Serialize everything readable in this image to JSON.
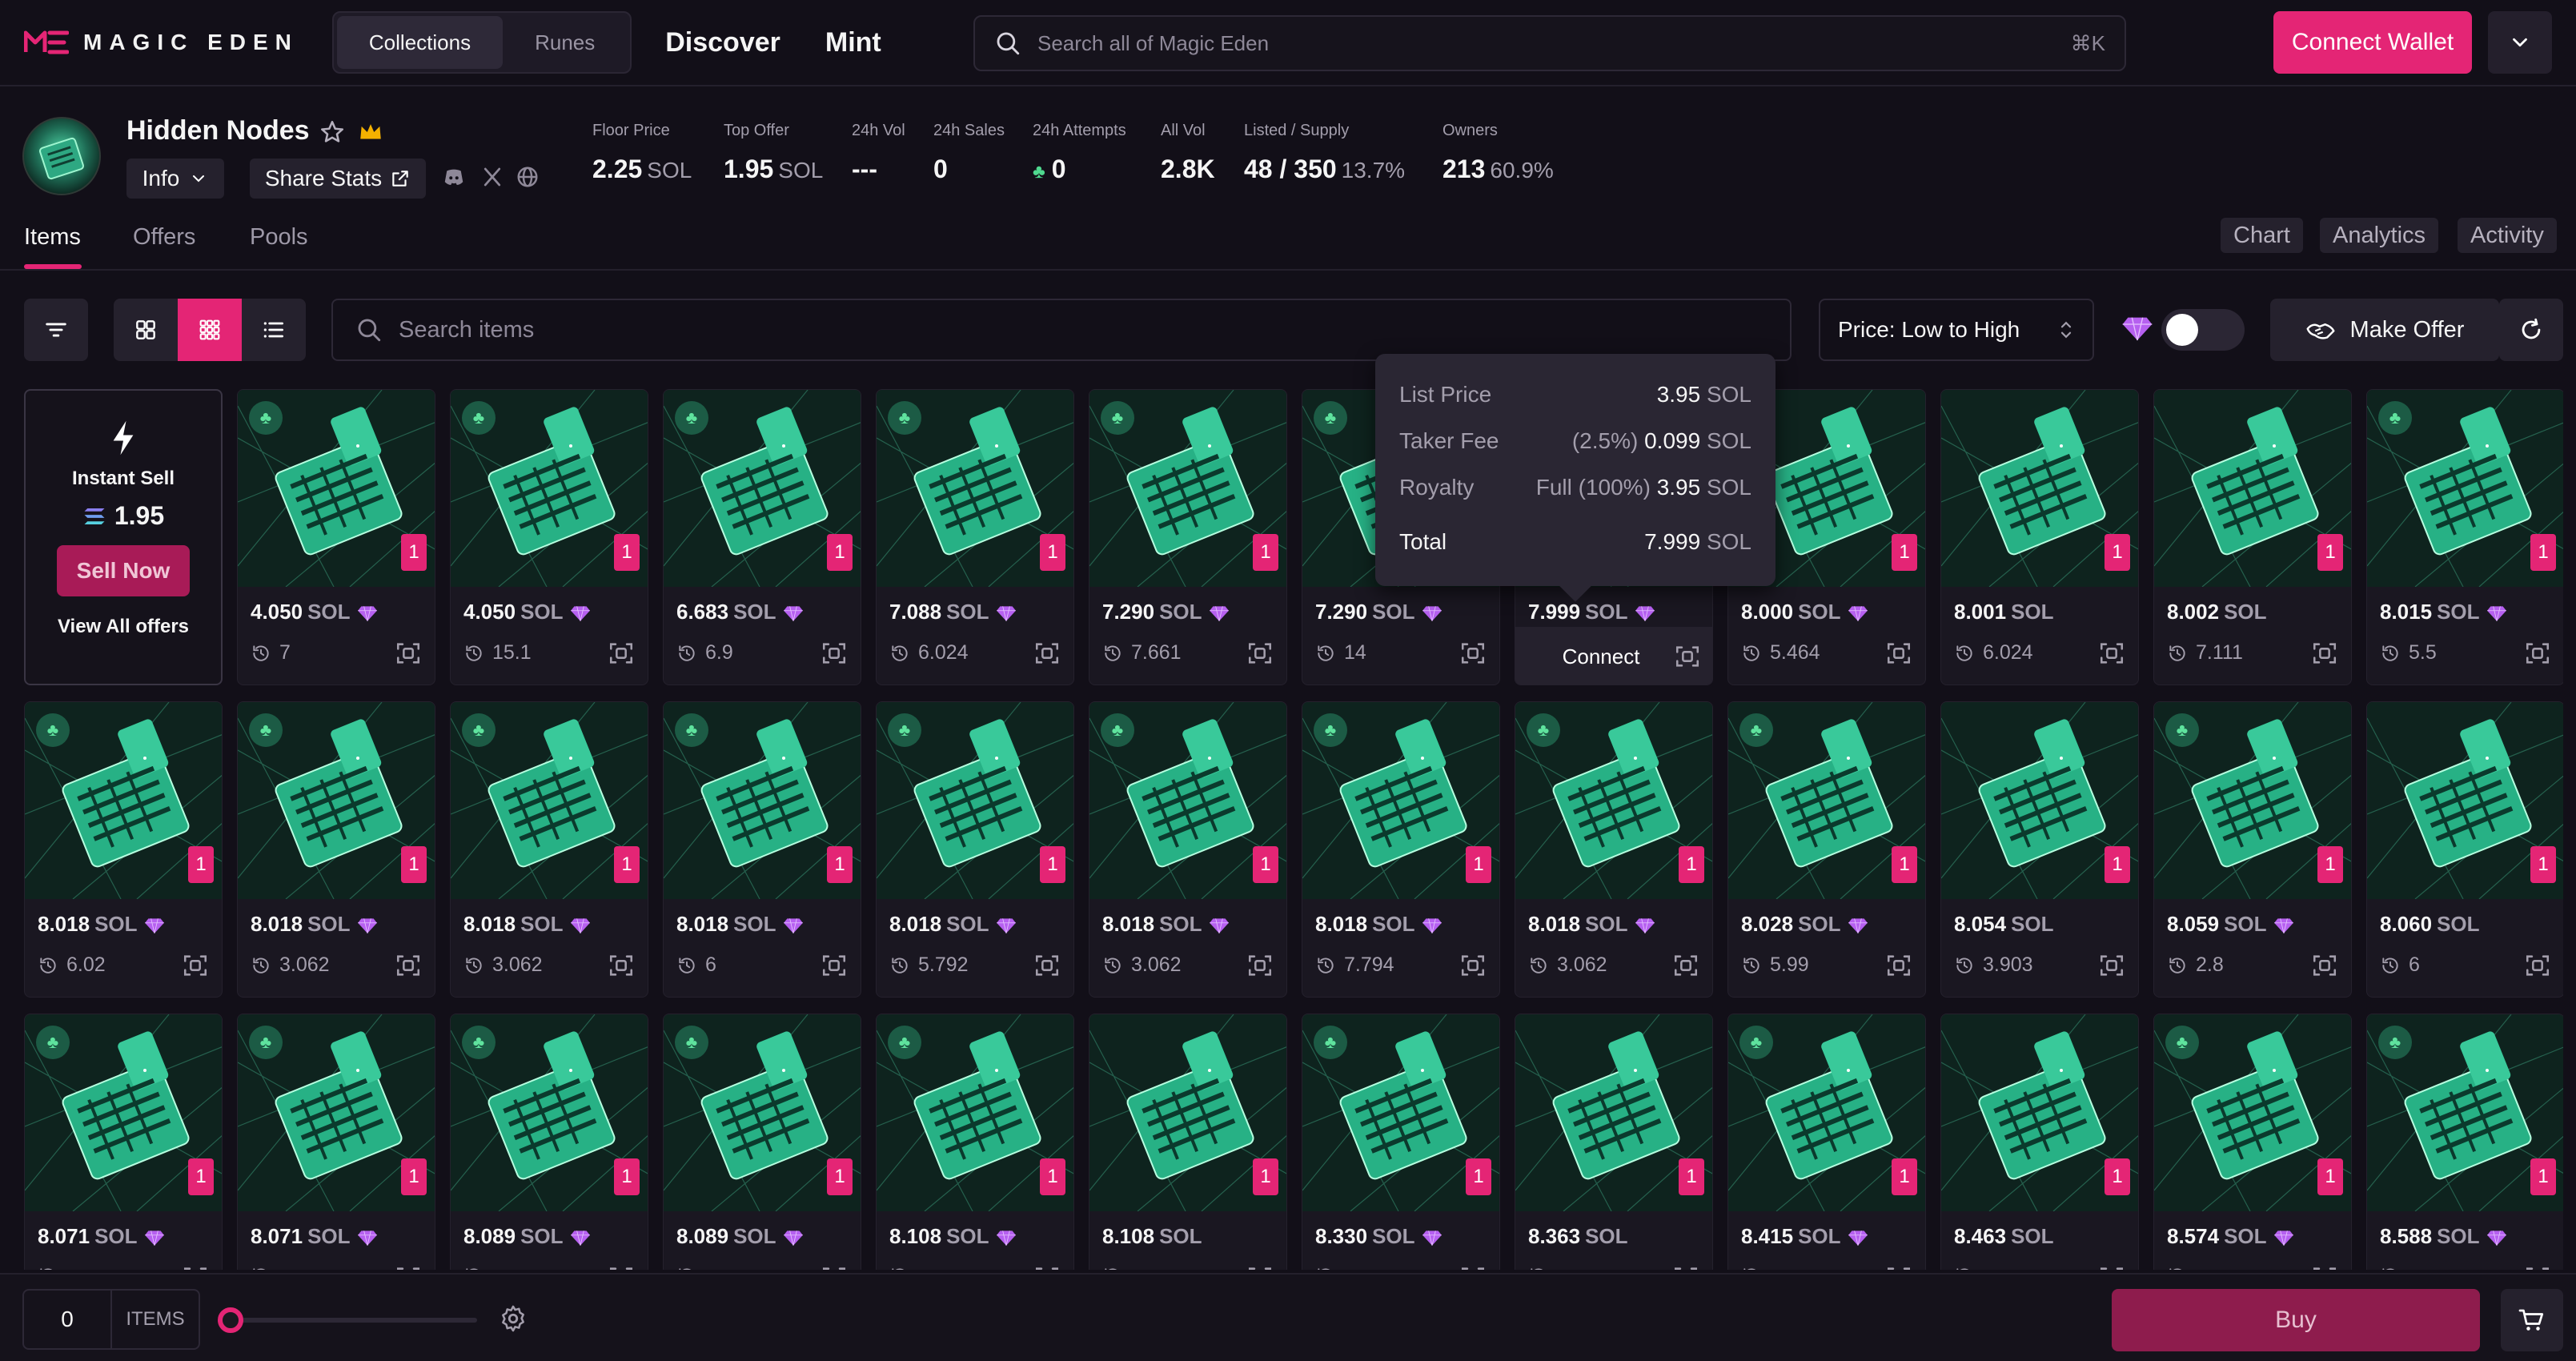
{
  "brand": {
    "name": "MAGIC EDEN",
    "accent": "#e42575"
  },
  "nav": {
    "segments": [
      "Collections",
      "Runes"
    ],
    "active_segment": "Collections",
    "links": [
      "Discover",
      "Mint"
    ]
  },
  "search": {
    "placeholder": "Search all of Magic Eden",
    "shortcut": "⌘K"
  },
  "wallet": {
    "connect_label": "Connect Wallet"
  },
  "collection": {
    "name": "Hidden Nodes",
    "info_label": "Info",
    "share_label": "Share Stats",
    "stats": [
      {
        "label": "Floor Price",
        "value": "2.25",
        "sub": "SOL"
      },
      {
        "label": "Top Offer",
        "value": "1.95",
        "sub": "SOL"
      },
      {
        "label": "24h Vol",
        "value": "---",
        "sub": ""
      },
      {
        "label": "24h Sales",
        "value": "0",
        "sub": ""
      },
      {
        "label": "24h Attempts",
        "value": "0",
        "sub": ""
      },
      {
        "label": "All Vol",
        "value": "2.8K",
        "sub": ""
      },
      {
        "label": "Listed / Supply",
        "value": "48 / 350",
        "sub": "13.7%"
      },
      {
        "label": "Owners",
        "value": "213",
        "sub": "60.9%"
      }
    ]
  },
  "tabs": {
    "left": [
      "Items",
      "Offers",
      "Pools"
    ],
    "active": "Items",
    "right": [
      "Chart",
      "Analytics",
      "Activity"
    ]
  },
  "toolbar": {
    "search_placeholder": "Search items",
    "sort_label": "Price: Low to High",
    "make_offer_label": "Make Offer"
  },
  "instant_sell": {
    "title": "Instant Sell",
    "amount": "1.95",
    "sell_label": "Sell Now",
    "view_offers_label": "View All offers"
  },
  "cards": [
    {
      "price": "4.050",
      "unit": "SOL",
      "gem": true,
      "last": "7",
      "clover": true,
      "qty": "1"
    },
    {
      "price": "4.050",
      "unit": "SOL",
      "gem": true,
      "last": "15.1",
      "clover": true,
      "qty": "1"
    },
    {
      "price": "6.683",
      "unit": "SOL",
      "gem": true,
      "last": "6.9",
      "clover": true,
      "qty": "1"
    },
    {
      "price": "7.088",
      "unit": "SOL",
      "gem": true,
      "last": "6.024",
      "clover": true,
      "qty": "1"
    },
    {
      "price": "7.290",
      "unit": "SOL",
      "gem": true,
      "last": "7.661",
      "clover": true,
      "qty": "1"
    },
    {
      "price": "7.290",
      "unit": "SOL",
      "gem": true,
      "last": "14",
      "clover": true,
      "qty": "1"
    },
    {
      "price": "7.999",
      "unit": "SOL",
      "gem": true,
      "last": "",
      "clover": true,
      "qty": "1",
      "hover": true
    },
    {
      "price": "8.000",
      "unit": "SOL",
      "gem": true,
      "last": "5.464",
      "clover": false,
      "qty": "1"
    },
    {
      "price": "8.001",
      "unit": "SOL",
      "gem": false,
      "last": "6.024",
      "clover": false,
      "qty": "1"
    },
    {
      "price": "8.002",
      "unit": "SOL",
      "gem": false,
      "last": "7.111",
      "clover": false,
      "qty": "1"
    },
    {
      "price": "8.015",
      "unit": "SOL",
      "gem": true,
      "last": "5.5",
      "clover": true,
      "qty": "1"
    },
    {
      "price": "8.018",
      "unit": "SOL",
      "gem": true,
      "last": "6.02",
      "clover": true,
      "qty": "1"
    },
    {
      "price": "8.018",
      "unit": "SOL",
      "gem": true,
      "last": "3.062",
      "clover": true,
      "qty": "1"
    },
    {
      "price": "8.018",
      "unit": "SOL",
      "gem": true,
      "last": "3.062",
      "clover": true,
      "qty": "1"
    },
    {
      "price": "8.018",
      "unit": "SOL",
      "gem": true,
      "last": "6",
      "clover": true,
      "qty": "1"
    },
    {
      "price": "8.018",
      "unit": "SOL",
      "gem": true,
      "last": "5.792",
      "clover": true,
      "qty": "1"
    },
    {
      "price": "8.018",
      "unit": "SOL",
      "gem": true,
      "last": "3.062",
      "clover": true,
      "qty": "1"
    },
    {
      "price": "8.018",
      "unit": "SOL",
      "gem": true,
      "last": "7.794",
      "clover": true,
      "qty": "1"
    },
    {
      "price": "8.018",
      "unit": "SOL",
      "gem": true,
      "last": "3.062",
      "clover": true,
      "qty": "1"
    },
    {
      "price": "8.028",
      "unit": "SOL",
      "gem": true,
      "last": "5.99",
      "clover": true,
      "qty": "1"
    },
    {
      "price": "8.054",
      "unit": "SOL",
      "gem": false,
      "last": "3.903",
      "clover": false,
      "qty": "1"
    },
    {
      "price": "8.059",
      "unit": "SOL",
      "gem": true,
      "last": "2.8",
      "clover": true,
      "qty": "1"
    },
    {
      "price": "8.060",
      "unit": "SOL",
      "gem": false,
      "last": "6",
      "clover": false,
      "qty": "1"
    },
    {
      "price": "8.071",
      "unit": "SOL",
      "gem": true,
      "last": "",
      "clover": true,
      "qty": "1"
    },
    {
      "price": "8.071",
      "unit": "SOL",
      "gem": true,
      "last": "",
      "clover": true,
      "qty": "1"
    },
    {
      "price": "8.089",
      "unit": "SOL",
      "gem": true,
      "last": "",
      "clover": true,
      "qty": "1"
    },
    {
      "price": "8.089",
      "unit": "SOL",
      "gem": true,
      "last": "",
      "clover": true,
      "qty": "1"
    },
    {
      "price": "8.108",
      "unit": "SOL",
      "gem": true,
      "last": "",
      "clover": true,
      "qty": "1"
    },
    {
      "price": "8.108",
      "unit": "SOL",
      "gem": false,
      "last": "",
      "clover": false,
      "qty": "1"
    },
    {
      "price": "8.330",
      "unit": "SOL",
      "gem": true,
      "last": "",
      "clover": true,
      "qty": "1"
    },
    {
      "price": "8.363",
      "unit": "SOL",
      "gem": false,
      "last": "",
      "clover": false,
      "qty": "1"
    },
    {
      "price": "8.415",
      "unit": "SOL",
      "gem": true,
      "last": "",
      "clover": true,
      "qty": "1"
    },
    {
      "price": "8.463",
      "unit": "SOL",
      "gem": false,
      "last": "",
      "clover": false,
      "qty": "1"
    },
    {
      "price": "8.574",
      "unit": "SOL",
      "gem": true,
      "last": "",
      "clover": true,
      "qty": "1"
    },
    {
      "price": "8.588",
      "unit": "SOL",
      "gem": true,
      "last": "",
      "clover": true,
      "qty": "1"
    }
  ],
  "hover_card": {
    "connect_label": "Connect"
  },
  "tooltip": {
    "rows": [
      {
        "label": "List Price",
        "mid": "",
        "value": "3.95",
        "unit": "SOL"
      },
      {
        "label": "Taker Fee",
        "mid": "(2.5%)",
        "value": "0.099",
        "unit": "SOL"
      },
      {
        "label": "Royalty",
        "mid": "Full (100%)",
        "value": "3.95",
        "unit": "SOL"
      }
    ],
    "total": {
      "label": "Total",
      "value": "7.999",
      "unit": "SOL"
    }
  },
  "bottom": {
    "count": "0",
    "count_label": "ITEMS",
    "buy_label": "Buy"
  },
  "icons": [
    "search-icon",
    "star-icon",
    "crown-icon",
    "chevron-down-icon",
    "share-icon",
    "discord-icon",
    "x-icon",
    "globe-icon",
    "filter-icon",
    "grid-large-icon",
    "grid-small-icon",
    "list-icon",
    "gem-icon",
    "offer-icon",
    "refresh-icon",
    "clover-icon",
    "history-icon",
    "scan-icon",
    "bolt-icon",
    "solana-icon",
    "settings-icon",
    "cart-icon"
  ]
}
